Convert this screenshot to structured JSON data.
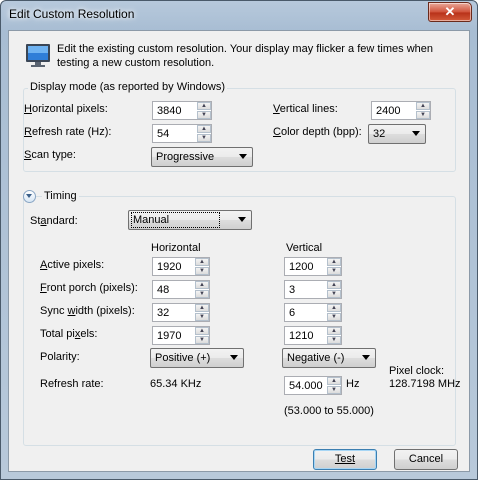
{
  "window": {
    "title": "Edit Custom Resolution",
    "close_label": "✕"
  },
  "intro_text": "Edit the existing custom resolution. Your display may flicker a few times when testing a new custom resolution.",
  "display_mode": {
    "group_label": "Display mode (as reported by Windows)",
    "horizontal_pixels": {
      "label": "Horizontal pixels:",
      "value": "3840"
    },
    "vertical_lines": {
      "label": "Vertical lines:",
      "value": "2400"
    },
    "refresh_rate": {
      "label": "Refresh rate (Hz):",
      "value": "54"
    },
    "color_depth": {
      "label": "Color depth (bpp):",
      "value": "32"
    },
    "scan_type": {
      "label": "Scan type:",
      "value": "Progressive"
    }
  },
  "timing": {
    "group_label": "Timing",
    "standard": {
      "label": "Standard:",
      "value": "Manual"
    },
    "col_horizontal": "Horizontal",
    "col_vertical": "Vertical",
    "rows": {
      "active": {
        "label": "Active pixels:",
        "h": "1920",
        "v": "1200"
      },
      "front_porch": {
        "label": "Front porch (pixels):",
        "h": "48",
        "v": "3"
      },
      "sync_width": {
        "label": "Sync width (pixels):",
        "h": "32",
        "v": "6"
      },
      "total": {
        "label": "Total pixels:",
        "h": "1970",
        "v": "1210"
      }
    },
    "polarity": {
      "label": "Polarity:",
      "h": "Positive (+)",
      "v": "Negative (-)"
    },
    "refresh": {
      "label": "Refresh rate:",
      "h_value": "65.34 KHz",
      "v_value": "54.000",
      "v_unit": "Hz",
      "range": "(53.000 to 55.000)"
    },
    "pixel_clock": {
      "label": "Pixel clock:",
      "value": "128.7198 MHz"
    }
  },
  "buttons": {
    "test": "Test",
    "cancel": "Cancel"
  },
  "icons": {
    "monitor": "monitor-icon",
    "expander": "chevron-down-icon"
  }
}
